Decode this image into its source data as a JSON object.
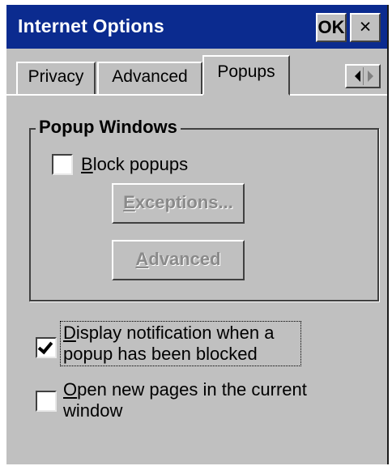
{
  "window": {
    "title": "Internet Options",
    "ok_label": "OK",
    "close_label": "×"
  },
  "tabs": [
    {
      "label": "Privacy",
      "selected": false
    },
    {
      "label": "Advanced",
      "selected": false
    },
    {
      "label": "Popups",
      "selected": true
    }
  ],
  "popup_group": {
    "title": "Popup Windows",
    "block_popups": {
      "pre": "",
      "mnemonic": "B",
      "post": "lock popups",
      "checked": false
    },
    "exceptions_button": {
      "pre": "",
      "mnemonic": "E",
      "post": "xceptions...",
      "enabled": false
    },
    "advanced_button": {
      "pre": "",
      "mnemonic": "A",
      "post": "dvanced",
      "enabled": false
    }
  },
  "options": {
    "display_notification": {
      "line1_mnemonic": "D",
      "line1_rest": "isplay notification when a",
      "line2": "popup has been blocked",
      "checked": true
    },
    "open_new_pages": {
      "line1_mnemonic": "O",
      "line1_rest": "pen new pages in the current",
      "line2": "window",
      "checked": false
    }
  }
}
